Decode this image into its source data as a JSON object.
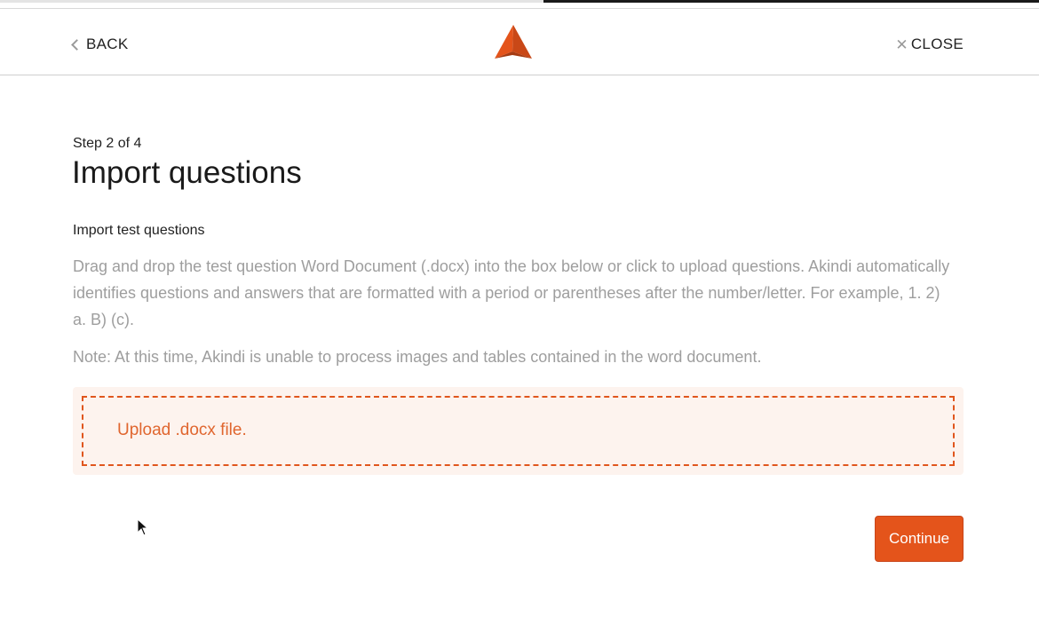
{
  "header": {
    "back_label": "BACK",
    "close_label": "CLOSE",
    "logo_icon": "akindi-triangle-logo"
  },
  "main": {
    "step": "Step 2 of 4",
    "title": "Import questions",
    "subheading": "Import test questions",
    "description": "Drag and drop the test question Word Document (.docx) into the box below or click to upload questions. Akindi automatically identifies questions and answers that are formatted with a period or parentheses after the number/letter. For example, 1. 2) a. B) (c).",
    "note": "Note: At this time, Akindi is unable to process images and tables contained in the word document.",
    "upload_label": "Upload .docx file.",
    "continue_label": "Continue"
  },
  "colors": {
    "accent": "#e4541b",
    "dropzone_bg": "#fdf3ee",
    "muted_text": "#9e9e9e"
  }
}
